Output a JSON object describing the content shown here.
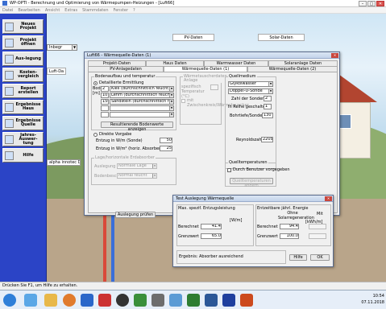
{
  "titlebar": {
    "title": "WP-OPTI - Berechnung und Optimierung von Wärmepumpen-Heizungen - [Luft66]"
  },
  "menu": [
    "Datei",
    "Bearbeiten",
    "Ansicht",
    "Extras",
    "Stammdaten",
    "Fenster",
    "?"
  ],
  "sidebar": [
    {
      "label": "Neues Projekt",
      "icon": "new-project-icon"
    },
    {
      "label": "Projekt öffnen",
      "icon": "open-folder-icon"
    },
    {
      "label": "Aus-legung",
      "icon": "design-icon"
    },
    {
      "label": "Kosten-vergleich",
      "icon": "cost-compare-icon"
    },
    {
      "label": "Report erstellen",
      "icon": "report-icon"
    },
    {
      "label": "Ergebnisse Haus",
      "icon": "house-results-icon"
    },
    {
      "label": "Ergebnisse Quelle",
      "icon": "source-results-icon"
    },
    {
      "label": "Jahres-Auswer-tung",
      "icon": "year-evaluation-icon"
    },
    {
      "label": "Hilfe",
      "icon": "help-icon"
    }
  ],
  "scene": {
    "combo_value": "Inbegr",
    "side_hint": "alpha innotec DAC",
    "labels": {
      "pv": "PV-Daten",
      "solar": "Solar-Daten",
      "luft": "Luft-Da"
    }
  },
  "dialog_quelle": {
    "title": "Luft66 - Wärmequelle-Daten (1)",
    "tabs_row1": [
      "Projekt-Daten",
      "Haus Daten",
      "Warmwasser Daten",
      "Solaranlage Daten"
    ],
    "tabs_row2": [
      "PV-Anlagedaten",
      "Wärmequelle-Daten (1)",
      "Wärmequelle-Daten (2)"
    ],
    "boden": {
      "group": "Bodenaufbau und temperatur",
      "detail": "Detaillierte Ermittlung",
      "col_head": [
        "Boden",
        "[m]"
      ],
      "rows": [
        {
          "depth": "2",
          "type": "Kies (durchschnittlich feucht)_(Bk)"
        },
        {
          "depth": "10",
          "type": "Lehm (durchschnittlich feucht)_(Bk)"
        },
        {
          "depth": "150",
          "type": "Sandstein (durchschnittlich feucht)_(Bk)"
        },
        {
          "depth": "",
          "type": ""
        },
        {
          "depth": "",
          "type": ""
        }
      ],
      "show_button": "Resultierende Bodenwerte anzeigen",
      "direct": "Direkte Vorgabe",
      "entzug_sonde_label": "Entzug in W/m (Sonde)",
      "entzug_sonde_value": "50",
      "entzug_horiz_label": "Entzug in W/m² (horiz. Absorber)",
      "entzug_horiz_value": "25"
    },
    "verlegung": {
      "group": "Lage/horizontale Erdabsorber",
      "lage_label": "Auslegung",
      "lage_value": "Normale Lage",
      "boden_label": "Bodenbeschaffen",
      "boden_value": "Normal feucht"
    },
    "mid": {
      "title": "Wärmetauscherdaten Anlage",
      "spez_label": "spezifisch Temperatur (°C)",
      "check_label": "mit Zwischenkreis/Wärmetauscher"
    },
    "quellmedium": {
      "group": "Quellmedium",
      "medium": "Glykolwasser",
      "typ": "Doppel-U-Sonde",
      "anzahl_label": "Zahl der Sonden",
      "anzahl_value": "2",
      "parallel_label": "In Reihe geschaltet je",
      "parallel_value": "1",
      "bohr_label": "Bohrtiefe/Sonde [m]",
      "bohr_value": "130",
      "reynolds_label": "Reynoldszahl",
      "reynolds_value": "2205"
    },
    "quelltemp": {
      "group": "Quelltemperaturen",
      "check_label": "Durch Benutzer vorgegeben",
      "btn": "Quelltemperaturen ändern"
    },
    "pruef_button": "Auslegung prüfen"
  },
  "dialog_test": {
    "title": "Test Auslegung Wärmequelle",
    "left_head": "Max. spezif. Entzugsleistung",
    "unit_w": "[W/m]",
    "ber_label": "Berechnet",
    "ber_value": "41.4",
    "grenz_label": "Grenzwert",
    "grenz_value": "65.0",
    "right_head": "Entzeitbare jährl. Energie",
    "ohne_label": "Ohne Solarregeneration",
    "mit_label": "Mit",
    "unit_kwh": "[kWh/m]",
    "r_ber_label": "Berechnet",
    "r_ber_value": "94.4",
    "r_grenz_label": "Grenzwert",
    "r_grenz_value": "100.0",
    "ergebnis_label": "Ergebnis:",
    "ergebnis_value": "Absorber ausreichend",
    "hilfe": "Hilfe",
    "ok": "OK"
  },
  "statusbar": {
    "text": "Drücken Sie F1, um Hilfe zu erhalten."
  },
  "tray": {
    "time": "10:54",
    "date": "07.11.2018"
  }
}
